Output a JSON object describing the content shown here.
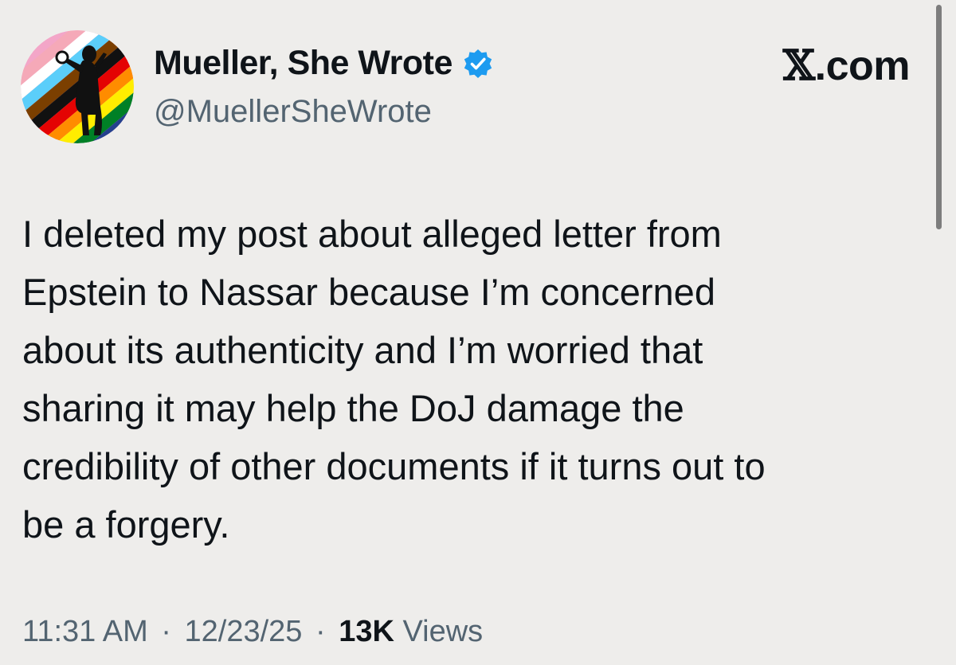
{
  "author": {
    "display_name": "Mueller, She Wrote",
    "handle": "@MuellerSheWrote",
    "verified_icon": "verified-badge-icon",
    "verified_color": "#1d9bf0"
  },
  "brand": {
    "glyph": "𝕏",
    "suffix": ".com"
  },
  "post": {
    "lines": [
      "I deleted my post about alleged letter from",
      "Epstein to Nassar because I’m concerned",
      "about its authenticity and I’m worried that",
      "sharing it may help the DoJ damage the",
      "credibility of other documents if it turns out to",
      "be a forgery."
    ]
  },
  "meta": {
    "time": "11:31 AM",
    "separator": "·",
    "date": "12/23/25",
    "views_count": "13K",
    "views_label": "Views"
  },
  "colors": {
    "background": "#eeedeb",
    "text": "#0f1419",
    "secondary_text": "#536471"
  }
}
